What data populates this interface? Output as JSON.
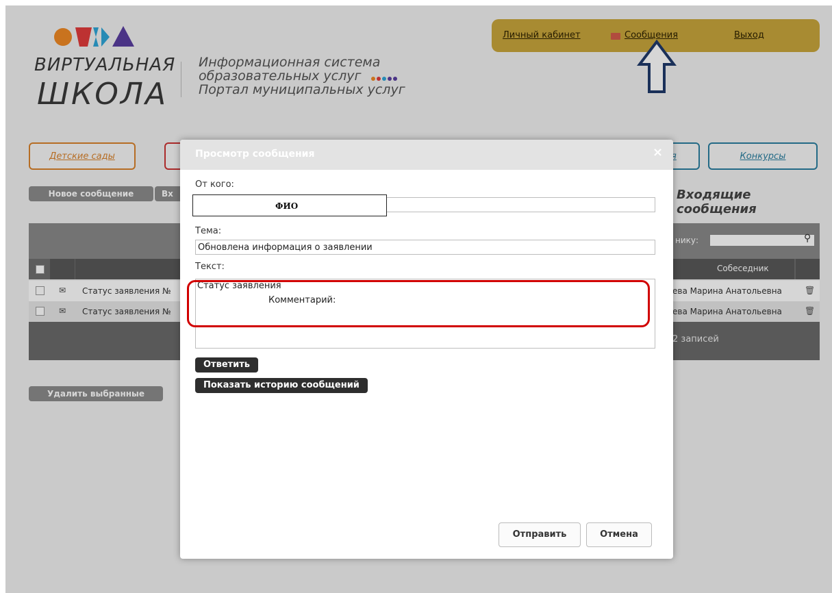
{
  "header": {
    "logo_line1": "ВИРТУАЛЬНАЯ",
    "logo_line2": "ШКОЛА",
    "tagline1": "Информационная система",
    "tagline2": "образовательных услуг",
    "tagline3": "Портал муниципальных услуг"
  },
  "userbar": {
    "cabinet": "Личный кабинет",
    "messages": "Сообщения",
    "logout": "Выход"
  },
  "nav": {
    "kindergartens": "Детские сады",
    "partial": "я",
    "contests": "Конкурсы"
  },
  "toolbar": {
    "new_message": "Новое сообщение",
    "inbox_partial": "Вх",
    "inbox_title": "Входящие сообщения",
    "delete_selected": "Удалить выбранные"
  },
  "table": {
    "search_label": "нику:",
    "col_interlocutor": "Собеседник",
    "rows": [
      {
        "subject": "Статус заявления №",
        "person": "ева Марина Анатольевна"
      },
      {
        "subject": "Статус заявления №",
        "person": "ева Марина Анатольевна"
      }
    ],
    "footer": "2 записей"
  },
  "modal": {
    "title": "Просмотр сообщения",
    "close": "×",
    "from_label": "От кого:",
    "from_value": "ФИО",
    "subject_label": "Тема:",
    "subject_value": "Обновлена информация о заявлении",
    "text_label": "Текст:",
    "text_line1": "Статус заявления",
    "text_line2": "Комментарий:",
    "reply": "Ответить",
    "show_history": "Показать историю сообщений",
    "send": "Отправить",
    "cancel": "Отмена"
  },
  "colors": {
    "userbar": "#c9a63c",
    "kindergartens_border": "#d9822b",
    "red_nav_border": "#cc3333",
    "contests_border": "#2a7fa0",
    "annotation_red": "#d10000",
    "annotation_arrow": "#1f3a6b"
  }
}
